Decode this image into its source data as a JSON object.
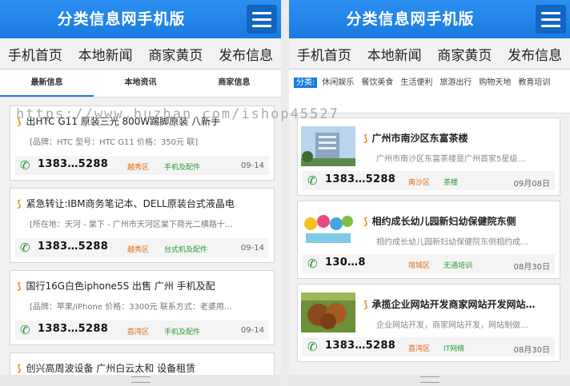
{
  "left": {
    "header_title": "分类信息网手机版",
    "nav": [
      "手机首页",
      "本地新闻",
      "商家黄页",
      "发布信息"
    ],
    "tabs": [
      "最新信息",
      "本地资讯",
      "商家信息"
    ],
    "listings": [
      {
        "title": "出HTC G11 原装三光 800W踢脚原装 八新手",
        "desc": "[品牌：HTC 型号：HTC G11 价格：350元 联]",
        "phone": "1383…5288",
        "area": "越秀区",
        "category": "手机及配件",
        "date": "09-14"
      },
      {
        "title": "紧急转让:IBM商务笔记本、DELL原装台式液晶电",
        "desc": "[所在地：天河 - 棠下 - 广州市天河区棠下荷光二横路十…",
        "phone": "1383…5288",
        "area": "越秀区",
        "category": "台式机及配件",
        "date": "09-14"
      },
      {
        "title": "国行16G白色iphone5S 出售 广州 手机及配",
        "desc": "[品牌：苹果/iPhone 价格：3300元 联系方式：老婆用…",
        "phone": "1383…5288",
        "area": "荔湾区",
        "category": "手机及配件",
        "date": "09-14"
      },
      {
        "title": "创兴高周波设备 广州白云太和 设备租赁",
        "desc": "",
        "phone": "",
        "area": "",
        "category": "",
        "date": ""
      }
    ]
  },
  "right": {
    "header_title": "分类信息网手机版",
    "nav": [
      "手机首页",
      "本地新闻",
      "商家黄页",
      "发布信息"
    ],
    "filter_label": "分类:",
    "filter_options": [
      "休闲娱乐",
      "餐饮美食",
      "生活便利",
      "旅游出行",
      "购物天地",
      "教育培训"
    ],
    "listings": [
      {
        "title": "广州市南沙区东富茶楼",
        "desc": "广州市南沙区东富茶楼是广州首家5星级…",
        "phone": "1383…5288",
        "area": "南沙区",
        "category": "茶楼",
        "date": "09月08日"
      },
      {
        "title": "相约成长幼儿园新妇幼保健院东侧",
        "desc": "相约成长幼儿园新妇幼保健院东侧相约成…",
        "phone": "130…8",
        "area": "增城区",
        "category": "无通培训",
        "date": "08月30日"
      },
      {
        "title": "承揽企业网站开发商家网站开发网站…",
        "desc": "企业网站开发，商家网站开发，网站制做…",
        "phone": "1383…5288",
        "area": "荔湾区",
        "category": "IT网络",
        "date": "08月30日"
      }
    ]
  },
  "watermark": "https://www.huzhan.com/ishop45527",
  "colors": {
    "header": "#1a7be2",
    "accent_orange": "#f08a1c",
    "accent_green": "#2a9a35"
  }
}
